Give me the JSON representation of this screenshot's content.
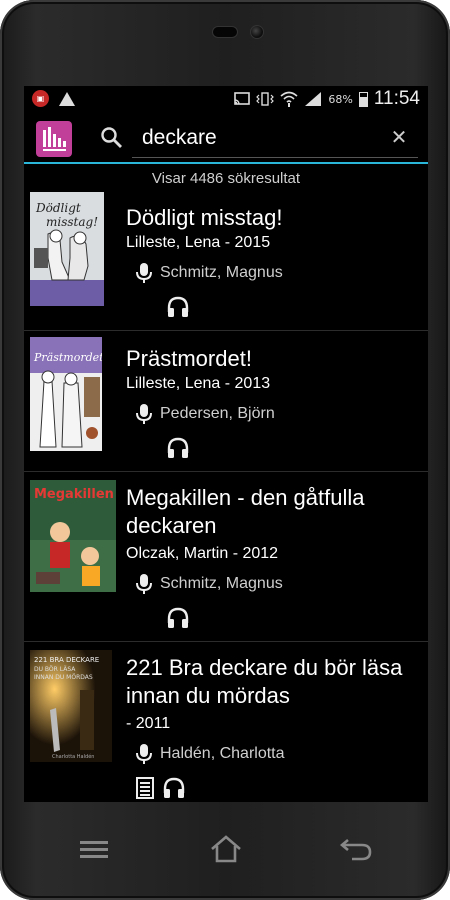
{
  "status_bar": {
    "battery": "68%",
    "time": "11:54",
    "icons": [
      "notification-app-icon",
      "warning-icon",
      "cast-icon",
      "vibrate-icon",
      "wifi-icon",
      "signal-icon",
      "battery-icon"
    ]
  },
  "app_bar": {
    "logo_icon": "app-logo-icon",
    "search_icon": "search-icon",
    "search_value": "deckare",
    "clear_icon": "clear-icon",
    "accent_color": "#29b6d8"
  },
  "results": {
    "count_text": "Visar 4486 sökresultat",
    "items": [
      {
        "title": "Dödligt misstag!",
        "author": "Lilleste, Lena",
        "year": " - 2015",
        "narrator": "Schmitz, Magnus",
        "formats": [
          "headphones-icon"
        ]
      },
      {
        "title": "Prästmordet!",
        "author": "Lilleste, Lena",
        "year": " - 2013",
        "narrator": "Pedersen, Björn",
        "formats": [
          "headphones-icon"
        ]
      },
      {
        "title": "Megakillen - den gåtfulla deckaren",
        "author": "Olczak, Martin",
        "year": " - 2012",
        "narrator": "Schmitz, Magnus",
        "formats": [
          "headphones-icon"
        ]
      },
      {
        "title": "221 Bra deckare du bör läsa innan du mördas",
        "author": "",
        "year": " - 2011",
        "narrator": "Haldén, Charlotta",
        "formats": [
          "text-book-icon",
          "headphones-icon"
        ]
      }
    ]
  },
  "nav_bar": {
    "icons": [
      "menu-icon",
      "home-icon",
      "back-icon"
    ]
  }
}
